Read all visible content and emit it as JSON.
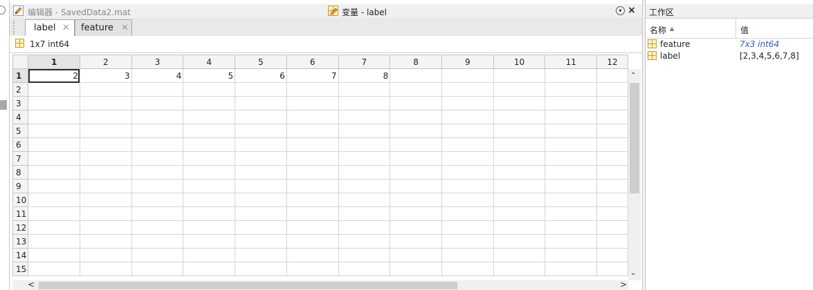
{
  "editor": {
    "title": "编辑器 - SavedData2.mat"
  },
  "variable_panel": {
    "title": "变量 - label",
    "close_label": "×",
    "collapse_label": "▾"
  },
  "tabs": [
    {
      "label": "label",
      "close": "✕",
      "active": true
    },
    {
      "label": "feature",
      "close": "✕",
      "active": false
    }
  ],
  "info": {
    "dimension_text": "1x7 int64"
  },
  "grid": {
    "column_headers": [
      "1",
      "2",
      "3",
      "4",
      "5",
      "6",
      "7",
      "8",
      "9",
      "10",
      "11",
      "12"
    ],
    "row_headers": [
      "1",
      "2",
      "3",
      "4",
      "5",
      "6",
      "7",
      "8",
      "9",
      "10",
      "11",
      "12",
      "13",
      "14",
      "15"
    ],
    "rows": [
      [
        "2",
        "3",
        "4",
        "5",
        "6",
        "7",
        "8",
        "",
        "",
        "",
        "",
        ""
      ]
    ],
    "active_cell": "1,1"
  },
  "scroll": {
    "up": "⌃",
    "down": "⌄",
    "left": "<",
    "right": ">"
  },
  "workspace": {
    "title": "工作区",
    "col_name": "名称",
    "sort_indicator": "▲",
    "col_value": "值",
    "items": [
      {
        "name": "feature",
        "value": "7x3 int64",
        "link": true
      },
      {
        "name": "label",
        "value": "[2,3,4,5,6,7,8]",
        "link": false
      }
    ]
  },
  "icons": [
    "pencil-icon",
    "variable-icon",
    "matrix-icon",
    "close-icon",
    "collapse-icon"
  ],
  "colors": {
    "active_row_header": "#e4e4e4",
    "link_value": "#2a62b8",
    "tab_bar": "#e9e9e9"
  }
}
